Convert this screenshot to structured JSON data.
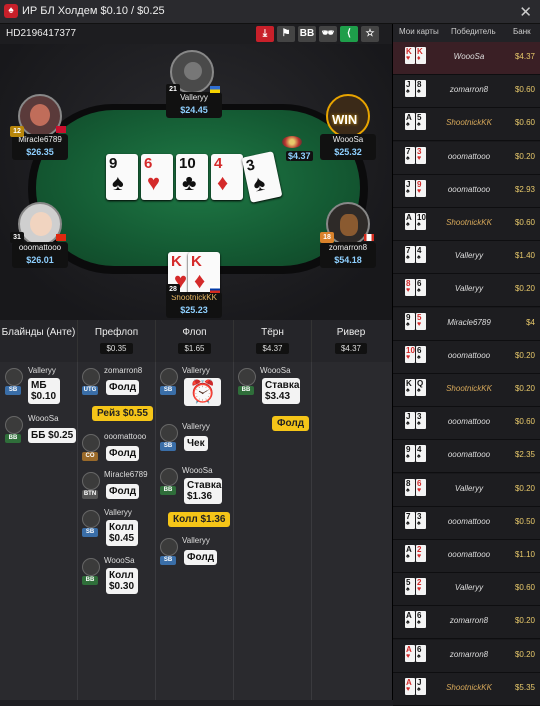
{
  "window": {
    "title": "ИР БЛ Холдем $0.10 / $0.25",
    "close": "✕"
  },
  "hand": {
    "id": "HD2196417377",
    "toolbar": [
      {
        "icon": "download-icon",
        "label": "⤓",
        "color": "#c8202a"
      },
      {
        "icon": "flag-icon",
        "label": "⚑",
        "color": "#444"
      },
      {
        "icon": "bb-icon",
        "label": "BB",
        "color": "#444"
      },
      {
        "icon": "spy-icon",
        "label": "🕶",
        "color": "#444"
      },
      {
        "icon": "share-icon",
        "label": "⟨",
        "color": "#1e9e4a"
      },
      {
        "icon": "star-icon",
        "label": "☆",
        "color": "#444"
      }
    ]
  },
  "board": [
    {
      "rank": "9",
      "suit": "♠",
      "red": false
    },
    {
      "rank": "6",
      "suit": "♥",
      "red": true
    },
    {
      "rank": "10",
      "suit": "♣",
      "red": false
    },
    {
      "rank": "4",
      "suit": "♦",
      "red": true
    },
    {
      "rank": "3",
      "suit": "♠",
      "red": false
    }
  ],
  "pot": "$4.37",
  "seats": {
    "valleryy": {
      "name": "Valleryy",
      "stack": "$24.45",
      "level": "21"
    },
    "miracle": {
      "name": "Miracle6789",
      "stack": "$26.35",
      "level": "12"
    },
    "woosa": {
      "name": "WoooSa",
      "stack": "$25.32",
      "badge": "WIN"
    },
    "ooomattooo": {
      "name": "ooomattooo",
      "stack": "$26.01",
      "level": "31"
    },
    "zomarron": {
      "name": "zomarron8",
      "stack": "$54.18",
      "level": "18"
    },
    "shootnick": {
      "name": "ShootnickKK",
      "stack": "$25.23",
      "level": "28",
      "cards": [
        {
          "rank": "K",
          "suit": "♥"
        },
        {
          "rank": "K",
          "suit": "♦"
        }
      ]
    }
  },
  "streets": [
    {
      "label": "Блайнды (Анте)",
      "pot": ""
    },
    {
      "label": "Префлоп",
      "pot": "$0.35"
    },
    {
      "label": "Флоп",
      "pot": "$1.65"
    },
    {
      "label": "Тёрн",
      "pot": "$4.37"
    },
    {
      "label": "Ривер",
      "pot": "$4.37"
    }
  ],
  "actions": {
    "blinds": [
      {
        "name": "Valleryy",
        "pos": "SB",
        "text": "МБ $0.10"
      },
      {
        "name": "WoooSa",
        "pos": "BB",
        "text": "ББ $0.25"
      }
    ],
    "preflop": [
      {
        "name": "zomarron8",
        "pos": "UTG",
        "text": "Фолд"
      },
      {
        "raise": "Рейз $0.55"
      },
      {
        "name": "ooomattooo",
        "pos": "CO",
        "text": "Фолд"
      },
      {
        "name": "Miracle6789",
        "pos": "BTN",
        "text": "Фолд"
      },
      {
        "name": "Valleryy",
        "pos": "SB",
        "text": "Колл $0.45"
      },
      {
        "name": "WoooSa",
        "pos": "BB",
        "text": "Колл $0.30"
      }
    ],
    "flop": [
      {
        "name": "Valleryy",
        "pos": "SB",
        "text": "⏰"
      },
      {
        "name": "Valleryy",
        "pos": "SB",
        "text": "Чек"
      },
      {
        "name": "WoooSa",
        "pos": "BB",
        "text": "Ставка $1.36"
      },
      {
        "call": "Колл $1.36"
      },
      {
        "name": "Valleryy",
        "pos": "SB",
        "text": "Фолд"
      }
    ],
    "turn": [
      {
        "name": "WoooSa",
        "pos": "BB",
        "text": "Ставка $3.43"
      },
      {
        "fold": "Фолд"
      }
    ]
  },
  "history": {
    "headers": [
      "Мои карты",
      "Победитель",
      "Банк"
    ],
    "rows": [
      {
        "c1": "K",
        "s1": "♥",
        "c2": "K",
        "s2": "♦",
        "winner": "WoooSa",
        "pot": "$4.37",
        "mine": false
      },
      {
        "c1": "J",
        "s1": "♠",
        "c2": "8",
        "s2": "♠",
        "winner": "zomarron8",
        "pot": "$0.60",
        "mine": false
      },
      {
        "c1": "A",
        "s1": "♠",
        "c2": "5",
        "s2": "♠",
        "winner": "ShootnickKK",
        "pot": "$0.60",
        "mine": true
      },
      {
        "c1": "7",
        "s1": "♠",
        "c2": "3",
        "s2": "♥",
        "winner": "ooomattooo",
        "pot": "$0.20",
        "mine": false
      },
      {
        "c1": "J",
        "s1": "♠",
        "c2": "9",
        "s2": "♥",
        "winner": "ooomattooo",
        "pot": "$2.93",
        "mine": false
      },
      {
        "c1": "A",
        "s1": "♠",
        "c2": "10",
        "s2": "♠",
        "winner": "ShootnickKK",
        "pot": "$0.60",
        "mine": true
      },
      {
        "c1": "7",
        "s1": "♠",
        "c2": "4",
        "s2": "♠",
        "winner": "Valleryy",
        "pot": "$1.40",
        "mine": false
      },
      {
        "c1": "8",
        "s1": "♥",
        "c2": "6",
        "s2": "♠",
        "winner": "Valleryy",
        "pot": "$0.20",
        "mine": false
      },
      {
        "c1": "9",
        "s1": "♠",
        "c2": "5",
        "s2": "♥",
        "winner": "Miracle6789",
        "pot": "$4",
        "mine": false
      },
      {
        "c1": "10",
        "s1": "♥",
        "c2": "6",
        "s2": "♠",
        "winner": "ooomattooo",
        "pot": "$0.20",
        "mine": false
      },
      {
        "c1": "K",
        "s1": "♠",
        "c2": "Q",
        "s2": "♠",
        "winner": "ShootnickKK",
        "pot": "$0.20",
        "mine": true
      },
      {
        "c1": "J",
        "s1": "♠",
        "c2": "3",
        "s2": "♠",
        "winner": "ooomattooo",
        "pot": "$0.60",
        "mine": false
      },
      {
        "c1": "9",
        "s1": "♠",
        "c2": "4",
        "s2": "♠",
        "winner": "ooomattooo",
        "pot": "$2.35",
        "mine": false
      },
      {
        "c1": "8",
        "s1": "♠",
        "c2": "6",
        "s2": "♥",
        "winner": "Valleryy",
        "pot": "$0.20",
        "mine": false
      },
      {
        "c1": "7",
        "s1": "♠",
        "c2": "3",
        "s2": "♠",
        "winner": "ooomattooo",
        "pot": "$0.50",
        "mine": false
      },
      {
        "c1": "A",
        "s1": "♠",
        "c2": "2",
        "s2": "♥",
        "winner": "ooomattooo",
        "pot": "$1.10",
        "mine": false
      },
      {
        "c1": "5",
        "s1": "♠",
        "c2": "2",
        "s2": "♥",
        "winner": "Valleryy",
        "pot": "$0.60",
        "mine": false
      },
      {
        "c1": "A",
        "s1": "♠",
        "c2": "6",
        "s2": "♠",
        "winner": "zomarron8",
        "pot": "$0.20",
        "mine": false
      },
      {
        "c1": "A",
        "s1": "♥",
        "c2": "6",
        "s2": "♠",
        "winner": "zomarron8",
        "pot": "$0.20",
        "mine": false
      },
      {
        "c1": "A",
        "s1": "♥",
        "c2": "J",
        "s2": "♠",
        "winner": "ShootnickKK",
        "pot": "$5.35",
        "mine": true
      }
    ]
  },
  "colors": {
    "accent_red": "#c8202a",
    "felt": "#1f7a46",
    "stack": "#8fd0ff",
    "gold": "#d6a85a",
    "pot_yellow": "#e8c96b",
    "sb": "#3a6ea8",
    "bb": "#2f6e3a",
    "utg": "#3a6ea8",
    "co": "#9a6a2a",
    "btn": "#555"
  }
}
